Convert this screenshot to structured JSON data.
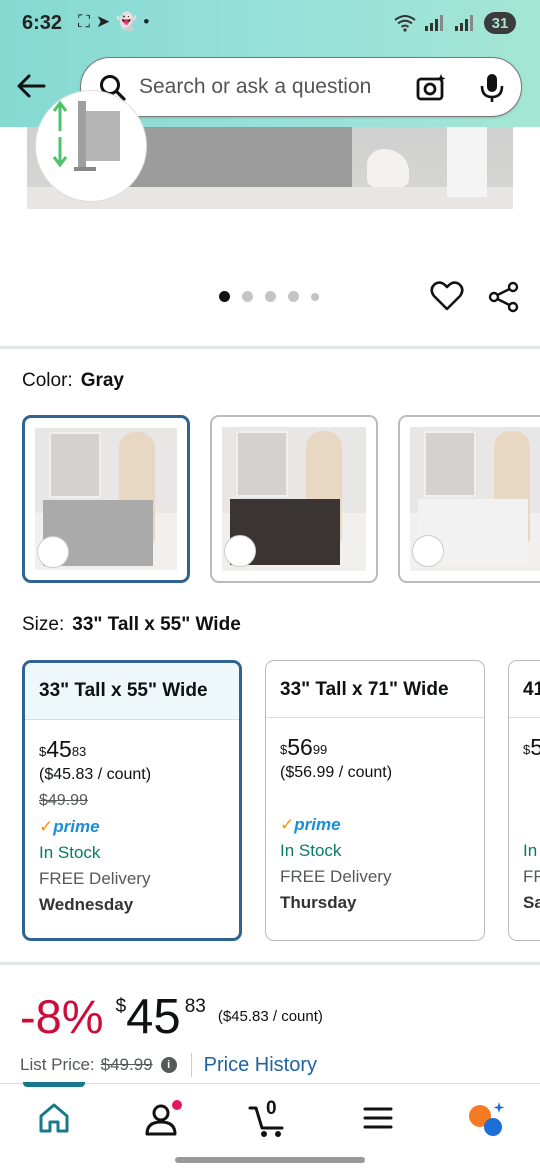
{
  "status_bar": {
    "time": "6:32",
    "battery": "31"
  },
  "search": {
    "placeholder": "Search or ask a question"
  },
  "carousel": {
    "dots": 5,
    "active_index": 0
  },
  "color": {
    "label": "Color:",
    "value": "Gray",
    "options": [
      "Gray",
      "Black",
      "White"
    ]
  },
  "size": {
    "label": "Size:",
    "value": "33\" Tall x 55\" Wide",
    "options": [
      {
        "title": "33\" Tall x 55\" Wide",
        "currency": "$",
        "whole": "45",
        "fraction": "83",
        "unit_price": "($45.83 / count)",
        "list_price": "$49.99",
        "prime": "prime",
        "stock": "In Stock",
        "delivery": "FREE Delivery",
        "delivery_day": "Wednesday"
      },
      {
        "title": "33\" Tall x 71\" Wide",
        "currency": "$",
        "whole": "56",
        "fraction": "99",
        "unit_price": "($56.99 / count)",
        "list_price": "",
        "prime": "prime",
        "stock": "In Stock",
        "delivery": "FREE Delivery",
        "delivery_day": "Thursday"
      },
      {
        "title": "41",
        "currency": "$",
        "whole": "5",
        "stock": "In",
        "delivery": "FR",
        "delivery_day": "Sa"
      }
    ]
  },
  "pricing": {
    "discount": "-8%",
    "currency": "$",
    "whole": "45",
    "fraction": "83",
    "unit_price": "($45.83 / count)",
    "list_label": "List Price:",
    "list_price": "$49.99",
    "price_history": "Price History"
  },
  "colors": {
    "header_start": "#84d9d1",
    "selected_border": "#2f6392",
    "discount": "#cc0c39",
    "in_stock": "#067d62",
    "link": "#2162a1",
    "prime": "#1a8fd6",
    "nav_active": "#167a8c"
  },
  "bottom_nav": {
    "cart_count": "0",
    "items": [
      "home-icon",
      "account-icon",
      "cart-icon",
      "menu-icon",
      "rufus-icon"
    ]
  }
}
